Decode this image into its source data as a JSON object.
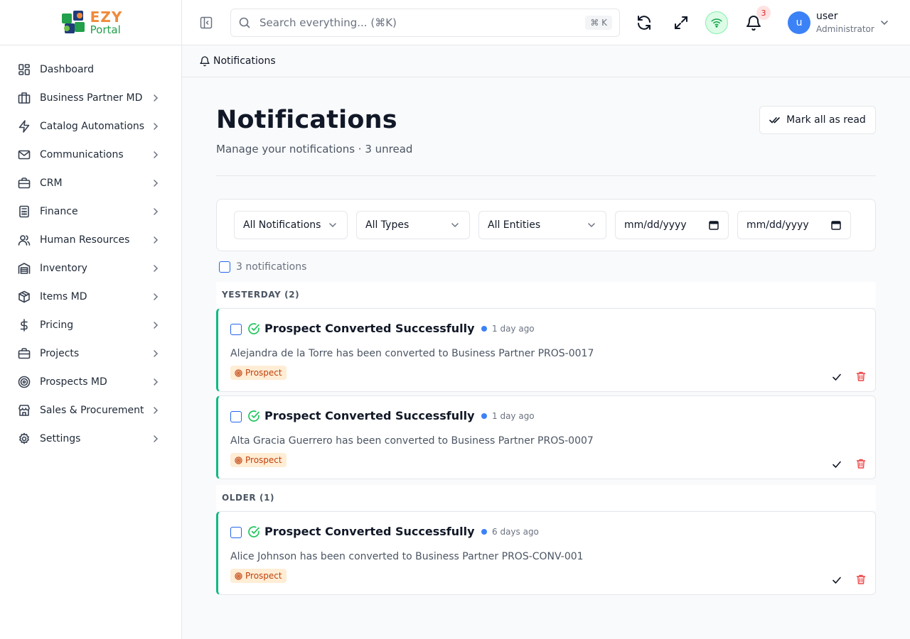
{
  "brand": {
    "line1": "EZY",
    "line2": "Portal"
  },
  "sidebar": {
    "items": [
      {
        "label": "Dashboard",
        "icon": "dashboard-icon",
        "has_children": false
      },
      {
        "label": "Business Partner MD",
        "icon": "building-icon",
        "has_children": true
      },
      {
        "label": "Catalog Automations",
        "icon": "zap-icon",
        "has_children": true
      },
      {
        "label": "Communications",
        "icon": "mail-icon",
        "has_children": true
      },
      {
        "label": "CRM",
        "icon": "briefcase-icon",
        "has_children": true
      },
      {
        "label": "Finance",
        "icon": "calculator-icon",
        "has_children": true
      },
      {
        "label": "Human Resources",
        "icon": "users-icon",
        "has_children": true
      },
      {
        "label": "Inventory",
        "icon": "warehouse-icon",
        "has_children": true
      },
      {
        "label": "Items MD",
        "icon": "package-icon",
        "has_children": true
      },
      {
        "label": "Pricing",
        "icon": "dollar-icon",
        "has_children": true
      },
      {
        "label": "Projects",
        "icon": "briefcase-icon",
        "has_children": true
      },
      {
        "label": "Prospects MD",
        "icon": "target-icon",
        "has_children": true
      },
      {
        "label": "Sales & Procurement",
        "icon": "store-icon",
        "has_children": true
      },
      {
        "label": "Settings",
        "icon": "gear-icon",
        "has_children": true
      }
    ]
  },
  "topbar": {
    "search_placeholder": "Search everything... (⌘K)",
    "search_shortcut": "⌘ K",
    "notification_count": "3",
    "user": {
      "initial": "u",
      "name": "user",
      "role": "Administrator"
    }
  },
  "breadcrumb": {
    "label": "Notifications"
  },
  "page": {
    "title": "Notifications",
    "subtitle": "Manage your notifications · 3 unread",
    "mark_all_label": "Mark all as read"
  },
  "filters": {
    "status": "All Notifications",
    "type": "All Types",
    "entity": "All Entities",
    "date_from": "mm/dd/yyyy",
    "date_to": "mm/dd/yyyy"
  },
  "select_all_label": "3 notifications",
  "groups": [
    {
      "header": "YESTERDAY (2)",
      "items": [
        {
          "title": "Prospect Converted Successfully",
          "time": "1 day ago",
          "message": "Alejandra de la Torre has been converted to Business Partner PROS-0017",
          "tag": "Prospect"
        },
        {
          "title": "Prospect Converted Successfully",
          "time": "1 day ago",
          "message": "Alta Gracia Guerrero has been converted to Business Partner PROS-0007",
          "tag": "Prospect"
        }
      ]
    },
    {
      "header": "OLDER (1)",
      "items": [
        {
          "title": "Prospect Converted Successfully",
          "time": "6 days ago",
          "message": "Alice Johnson has been converted to Business Partner PROS-CONV-001",
          "tag": "Prospect"
        }
      ]
    }
  ],
  "colors": {
    "accent": "#3b82f6",
    "success": "#10b981",
    "tag_bg": "#ffedd5",
    "tag_text": "#c2410c",
    "danger": "#ef4444"
  }
}
